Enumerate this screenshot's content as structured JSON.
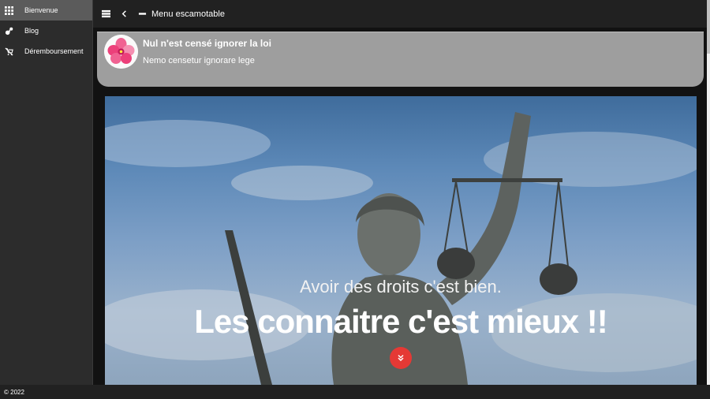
{
  "sidebar": {
    "items": [
      {
        "label": "Bienvenue",
        "icon": "grid-icon",
        "active": true
      },
      {
        "label": "Blog",
        "icon": "blog-icon",
        "active": false
      },
      {
        "label": "Déremboursement",
        "icon": "cart-off-icon",
        "active": false
      }
    ]
  },
  "topbar": {
    "title": "Menu escamotable"
  },
  "header": {
    "title": "Nul n'est censé ignorer la loi",
    "subtitle": "Nemo censetur ignorare lege"
  },
  "hero": {
    "subtitle": "Avoir des droits c'est bien.",
    "headline": "Les connaitre c'est mieux !!"
  },
  "footer": {
    "text": "© 2022"
  },
  "colors": {
    "sidebar_bg": "#2c2c2c",
    "active_item": "#5b5b5b",
    "header_card": "#9e9e9e",
    "accent_button": "#e53935"
  }
}
